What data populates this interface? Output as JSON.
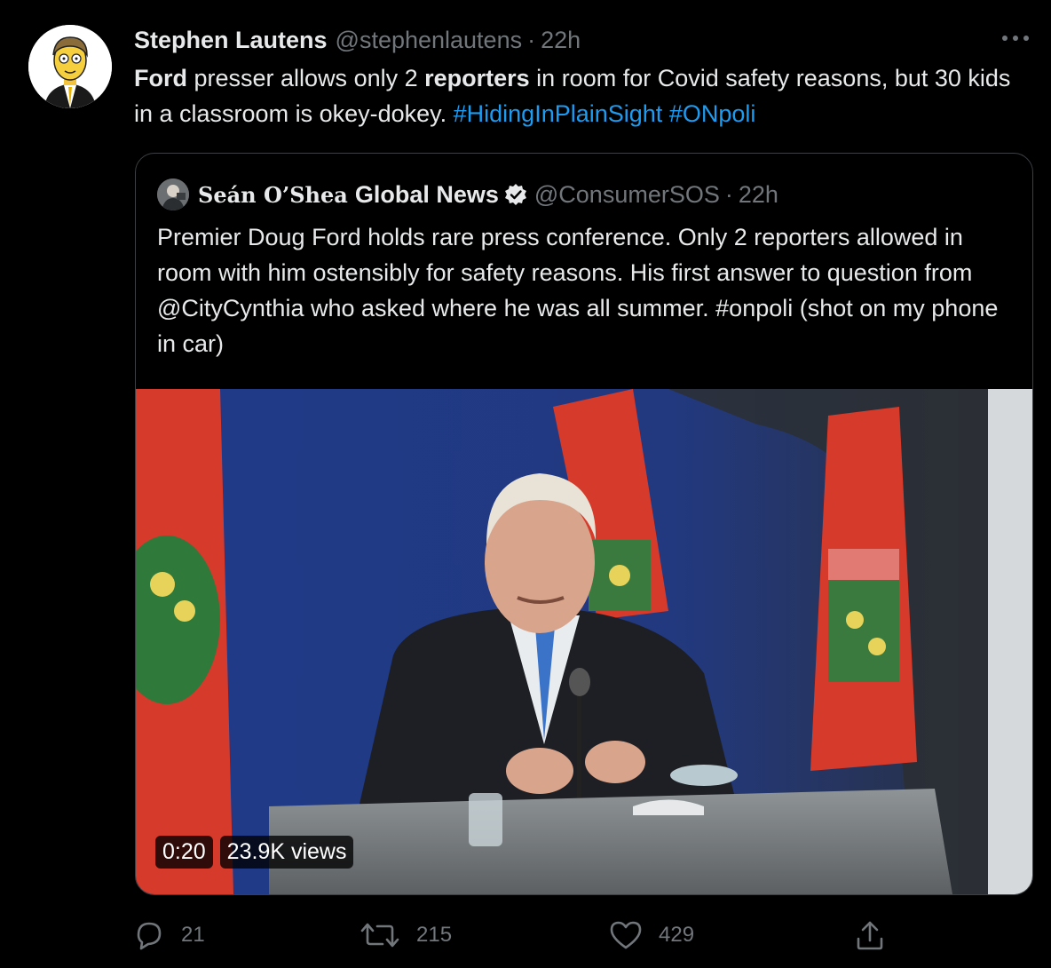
{
  "tweet": {
    "author_name": "Stephen Lautens",
    "author_handle": "@stephenlautens",
    "separator": "·",
    "time": "22h",
    "more_icon": "more-horizontal-icon",
    "text_parts": {
      "p1": "Ford",
      "p2": " presser allows only 2 ",
      "p3": "reporters",
      "p4": " in room for Covid safety reasons, but 30 kids in a classroom is okey-dokey. ",
      "tag1": "#HidingInPlainSight",
      "space": " ",
      "tag2": "#ONpoli"
    }
  },
  "quoted_tweet": {
    "name_part1": "Seán O’Shea",
    "name_part2": "Global News",
    "verified_icon": "verified-badge-icon",
    "handle": "@ConsumerSOS",
    "separator": "·",
    "time": "22h",
    "text": "Premier Doug Ford holds rare press conference. Only 2 reporters allowed in room with him ostensibly for safety reasons. His first answer to question from @CityCynthia who asked where he was all summer. #onpoli (shot on my phone in car)",
    "video": {
      "duration": "0:20",
      "views": "23.9K views"
    }
  },
  "actions": {
    "reply_count": "21",
    "retweet_count": "215",
    "like_count": "429",
    "icons": [
      "reply-icon",
      "retweet-icon",
      "like-icon",
      "share-icon"
    ]
  },
  "colors": {
    "background": "#000000",
    "text": "#e7e9ea",
    "muted": "#71767b",
    "link": "#1d9bf0",
    "border": "#3c4043"
  }
}
